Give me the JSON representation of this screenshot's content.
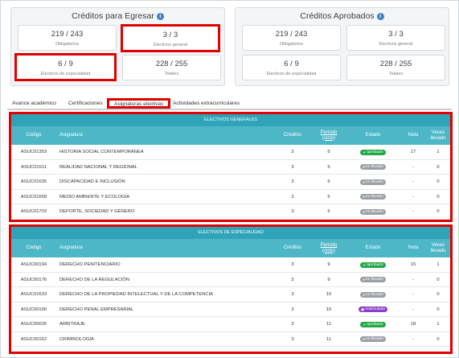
{
  "egresar": {
    "title": "Créditos para Egresar",
    "cards": [
      {
        "value": "219 / 243",
        "label": "Obligatorios"
      },
      {
        "value": "3 / 3",
        "label": "Electivos general"
      },
      {
        "value": "6 / 9",
        "label": "Electivos de especialidad"
      },
      {
        "value": "228 / 255",
        "label": "Totales"
      }
    ]
  },
  "aprobados": {
    "title": "Créditos Aprobados",
    "cards": [
      {
        "value": "219 / 243",
        "label": "Obligatorios"
      },
      {
        "value": "3 / 3",
        "label": "Electivos general"
      },
      {
        "value": "6 / 9",
        "label": "Electivos de especialidad"
      },
      {
        "value": "228 / 255",
        "label": "Totales"
      }
    ]
  },
  "tabs": [
    "Avance académico",
    "Certificaciones",
    "Asignaturas electivas",
    "Actividades extracurriculares"
  ],
  "columns": {
    "code": "Código",
    "subject": "Asignatura",
    "credits": "Créditos",
    "period_1": "Periodo",
    "period_2": "(ciclo)",
    "status": "Estado",
    "grade": "Nota",
    "times_1": "Veces",
    "times_2": "llevado"
  },
  "status_labels": {
    "aprobado": "aprobado",
    "no_llevado": "no llevado",
    "matriculado": "matriculado"
  },
  "colors": {
    "accent": "#2fa4b8",
    "header": "#4db7c8",
    "highlight": "#e00000",
    "approved": "#22a946",
    "not_taken": "#9aa0a6",
    "enrolled": "#8a3fc9"
  },
  "generales": {
    "title": "ELECTIVOS GENERALES",
    "rows": [
      {
        "code": "ASUC01353",
        "subject": "HISTORIA SOCIAL CONTEMPORÁNEA",
        "credits": "3",
        "period": "5",
        "status": "aprobado",
        "grade": "17",
        "times": "1"
      },
      {
        "code": "ASUC01511",
        "subject": "REALIDAD NACIONAL Y REGIONAL",
        "credits": "3",
        "period": "5",
        "status": "no_llevado",
        "grade": "-",
        "times": "0"
      },
      {
        "code": "ASUC01635",
        "subject": "DISCAPACIDAD E INCLUSIÓN",
        "credits": "3",
        "period": "5",
        "status": "no_llevado",
        "grade": "-",
        "times": "0"
      },
      {
        "code": "ASUC01658",
        "subject": "MEDIO AMBIENTE Y ECOLOGÍA",
        "credits": "3",
        "period": "5",
        "status": "no_llevado",
        "grade": "-",
        "times": "0"
      },
      {
        "code": "ASUC01703",
        "subject": "DEPORTE, SOCIEDAD Y GÉNERO",
        "credits": "3",
        "period": "5",
        "status": "no_llevado",
        "grade": "-",
        "times": "0"
      }
    ]
  },
  "especialidad": {
    "title": "ELECTIVOS DE ESPECIALIDAD",
    "rows": [
      {
        "code": "ASUC00194",
        "subject": "DERECHO PENITENCIARIO",
        "credits": "3",
        "period": "9",
        "status": "aprobado",
        "grade": "15",
        "times": "1"
      },
      {
        "code": "ASUC00176",
        "subject": "DERECHO DE LA REGULACIÓN",
        "credits": "3",
        "period": "9",
        "status": "no_llevado",
        "grade": "-",
        "times": "0"
      },
      {
        "code": "ASUC01633",
        "subject": "DERECHO DE LA PROPIEDAD INTELECTUAL Y DE LA COMPETENCIA",
        "credits": "3",
        "period": "10",
        "status": "no_llevado",
        "grade": "-",
        "times": "0"
      },
      {
        "code": "ASUC00190",
        "subject": "DERECHO PENAL EMPRESARIAL",
        "credits": "3",
        "period": "10",
        "status": "matriculado",
        "grade": "-",
        "times": "0"
      },
      {
        "code": "ASUC00035",
        "subject": "ARBITRAJE",
        "credits": "3",
        "period": "11",
        "status": "aprobado",
        "grade": "18",
        "times": "1"
      },
      {
        "code": "ASUC00162",
        "subject": "CRIMINOLOGÍA",
        "credits": "3",
        "period": "11",
        "status": "no_llevado",
        "grade": "-",
        "times": "0"
      }
    ]
  }
}
